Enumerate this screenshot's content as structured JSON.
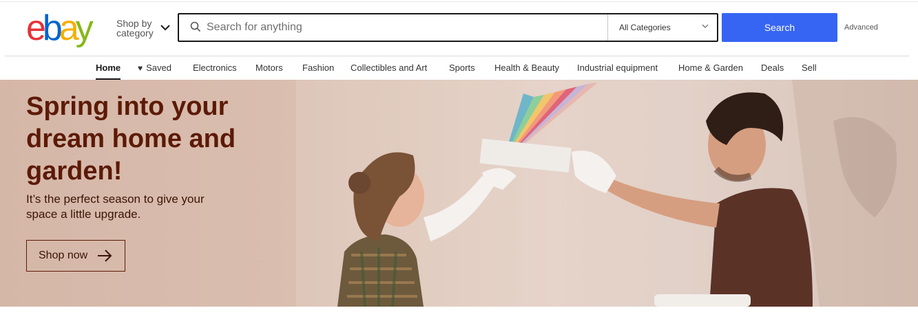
{
  "logo": {
    "letters": [
      "e",
      "b",
      "a",
      "y"
    ],
    "colors": [
      "#e53238",
      "#0064d2",
      "#f5af02",
      "#86b817"
    ]
  },
  "header": {
    "shop_by_category": "Shop by category",
    "search_placeholder": "Search for anything",
    "category_selected": "All Categories",
    "search_button": "Search",
    "advanced": "Advanced"
  },
  "nav": {
    "items": [
      "Home",
      "Saved",
      "Electronics",
      "Motors",
      "Fashion",
      "Collectibles and Art",
      "Sports",
      "Health & Beauty",
      "Industrial equipment",
      "Home & Garden",
      "Deals",
      "Sell"
    ],
    "active": "Home"
  },
  "hero": {
    "title": "Spring into your dream home and garden!",
    "subtitle": "It’s the perfect season to give your space a little upgrade.",
    "cta": "Shop now"
  },
  "colors": {
    "accent": "#3665f3",
    "hero_text": "#5c1a06"
  }
}
